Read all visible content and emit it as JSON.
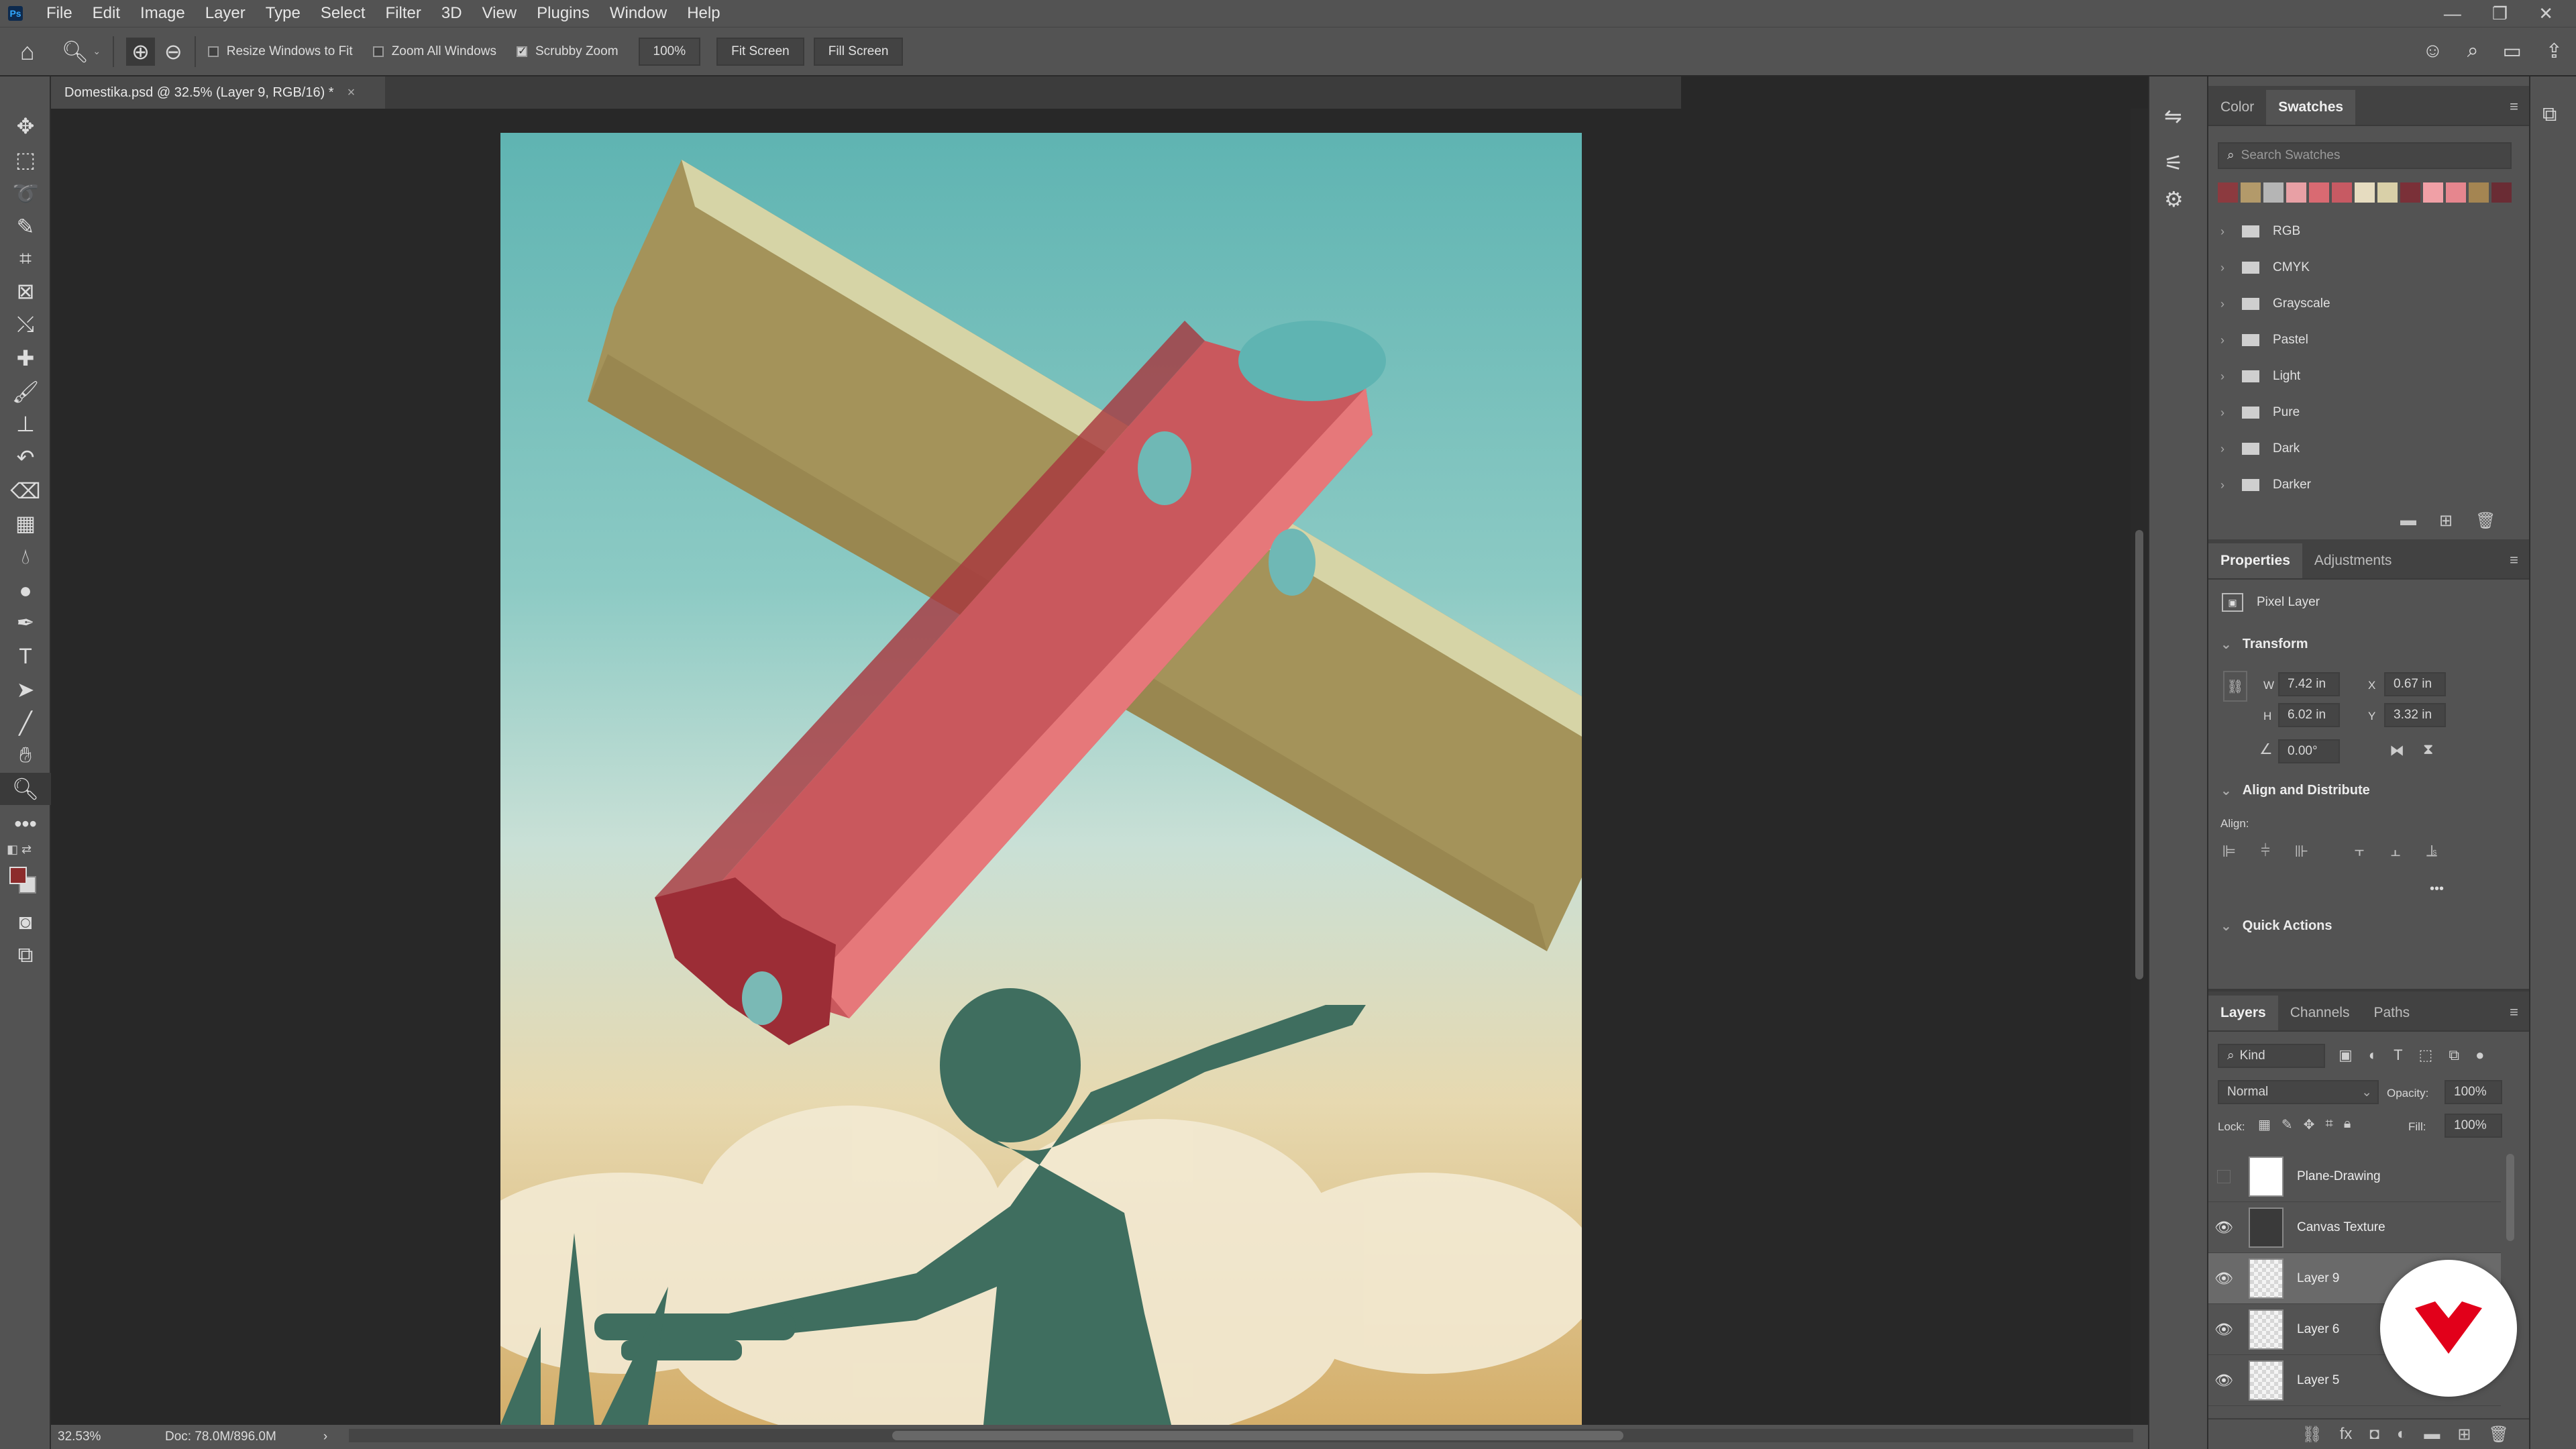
{
  "app": {
    "logo": "Ps"
  },
  "menu": [
    "File",
    "Edit",
    "Image",
    "Layer",
    "Type",
    "Select",
    "Filter",
    "3D",
    "View",
    "Plugins",
    "Window",
    "Help"
  ],
  "window_controls": {
    "minimize": "—",
    "restore": "❐",
    "close": "✕"
  },
  "options": {
    "resize_windows_label": "Resize Windows to Fit",
    "resize_windows_checked": false,
    "zoom_all_label": "Zoom All Windows",
    "zoom_all_checked": false,
    "scrubby_label": "Scrubby Zoom",
    "scrubby_checked": true,
    "zoom_value": "100%",
    "fit_screen": "Fit Screen",
    "fill_screen": "Fill Screen"
  },
  "document": {
    "tab_title": "Domestika.psd @ 32.5% (Layer 9, RGB/16) *",
    "close": "×"
  },
  "status": {
    "zoom": "32.53%",
    "doc_info": "Doc: 78.0M/896.0M",
    "arrow": "›"
  },
  "swatches_panel": {
    "tabs": [
      "Color",
      "Swatches"
    ],
    "active_tab": "Swatches",
    "search_placeholder": "Search Swatches",
    "recent_colors": [
      "#8c3a3f",
      "#b39a6a",
      "#b5b5b5",
      "#e8a0a5",
      "#d96a72",
      "#c75a63",
      "#e6dcc0",
      "#d9d0a8",
      "#7a3038",
      "#f0a0a6",
      "#e6868e",
      "#a48552",
      "#6a2c34"
    ],
    "groups": [
      "RGB",
      "CMYK",
      "Grayscale",
      "Pastel",
      "Light",
      "Pure",
      "Dark",
      "Darker"
    ]
  },
  "properties_panel": {
    "tabs": [
      "Properties",
      "Adjustments"
    ],
    "active_tab": "Properties",
    "layer_type": "Pixel Layer",
    "transform_title": "Transform",
    "w_label": "W",
    "w_value": "7.42 in",
    "h_label": "H",
    "h_value": "6.02 in",
    "x_label": "X",
    "x_value": "0.67 in",
    "y_label": "Y",
    "y_value": "3.32 in",
    "angle_value": "0.00°",
    "align_title": "Align and Distribute",
    "align_label": "Align:",
    "quick_actions_title": "Quick Actions",
    "more": "•••"
  },
  "layers_panel": {
    "tabs": [
      "Layers",
      "Channels",
      "Paths"
    ],
    "active_tab": "Layers",
    "filter_kind": "Kind",
    "blend_mode": "Normal",
    "opacity_label": "Opacity:",
    "opacity_value": "100%",
    "lock_label": "Lock:",
    "fill_label": "Fill:",
    "fill_value": "100%",
    "layers": [
      {
        "name": "Plane-Drawing",
        "visible": false,
        "selected": false
      },
      {
        "name": "Canvas Texture",
        "visible": true,
        "selected": false
      },
      {
        "name": "Layer 9",
        "visible": true,
        "selected": true
      },
      {
        "name": "Layer 6",
        "visible": true,
        "selected": false
      },
      {
        "name": "Layer 5",
        "visible": true,
        "selected": false
      }
    ]
  },
  "colors": {
    "accent": "#31a8ff",
    "foreground": "#8c2b2b",
    "background": "#d9d9d9",
    "badge": "#e2001a"
  }
}
